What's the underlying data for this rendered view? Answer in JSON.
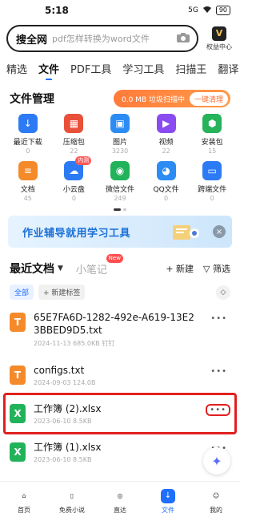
{
  "status": {
    "time": "5:18",
    "net": "5G",
    "battery": "90"
  },
  "search": {
    "brand": "搜全网",
    "placeholder": "pdf怎样转换为word文件"
  },
  "rights": {
    "label": "权益中心",
    "icon_text": "V"
  },
  "tabs": [
    {
      "label": "精选",
      "active": false
    },
    {
      "label": "文件",
      "active": true
    },
    {
      "label": "PDF工具",
      "active": false
    },
    {
      "label": "学习工具",
      "active": false
    },
    {
      "label": "扫描王",
      "active": false
    },
    {
      "label": "翻译",
      "active": false
    }
  ],
  "file_manager": {
    "title": "文件管理",
    "junk_text": "0.0 MB 垃圾扫描中",
    "clean_label": "一键清理",
    "categories": [
      {
        "label": "最近下载",
        "count": "0",
        "color": "#2d7bf4",
        "icon": "download-icon"
      },
      {
        "label": "压缩包",
        "count": "22",
        "color": "#e8503a",
        "icon": "archive-icon"
      },
      {
        "label": "图片",
        "count": "3230",
        "color": "#2d8cf4",
        "icon": "image-icon"
      },
      {
        "label": "视频",
        "count": "22",
        "color": "#8a4cf0",
        "icon": "video-icon"
      },
      {
        "label": "安装包",
        "count": "15",
        "color": "#27b35a",
        "icon": "apk-icon"
      },
      {
        "label": "文档",
        "count": "45",
        "color": "#f58a2a",
        "icon": "document-icon"
      },
      {
        "label": "小云盘",
        "count": "0",
        "color": "#2d7bf4",
        "icon": "cloud-icon",
        "badge": "内测"
      },
      {
        "label": "微信文件",
        "count": "249",
        "color": "#22b35a",
        "icon": "wechat-icon"
      },
      {
        "label": "QQ文件",
        "count": "0",
        "color": "#2d8cf4",
        "icon": "qq-icon"
      },
      {
        "label": "跨端文件",
        "count": "0",
        "color": "#2d7bf4",
        "icon": "cross-device-icon"
      }
    ]
  },
  "banner": {
    "text": "作业辅导就用学习工具"
  },
  "docs": {
    "title": "最近文档",
    "notes_label": "小笔记",
    "new_badge": "New",
    "new_label": "+ 新建",
    "filter_label": "筛选",
    "chip_all": "全部",
    "chip_new_tag": "+ 新建标签"
  },
  "files": [
    {
      "name": "65E7FA6D-1282-492e-A619-13E23BBED9D5.txt",
      "meta": "2024-11-13  685.0KB  钉钉",
      "type": "T",
      "selected": false
    },
    {
      "name": "configs.txt",
      "meta": "2024-09-03  124.0B",
      "type": "T",
      "selected": false
    },
    {
      "name": "工作簿 (2).xlsx",
      "meta": "2023-06-10  8.5KB",
      "type": "X",
      "selected": true
    },
    {
      "name": "工作簿 (1).xlsx",
      "meta": "2023-06-10  8.5KB",
      "type": "X",
      "selected": false
    }
  ],
  "more_glyph": "•••",
  "nav": [
    {
      "label": "首页",
      "active": false
    },
    {
      "label": "免费小说",
      "active": false
    },
    {
      "label": "直达",
      "active": false
    },
    {
      "label": "文件",
      "active": true
    },
    {
      "label": "我的",
      "active": false
    }
  ]
}
